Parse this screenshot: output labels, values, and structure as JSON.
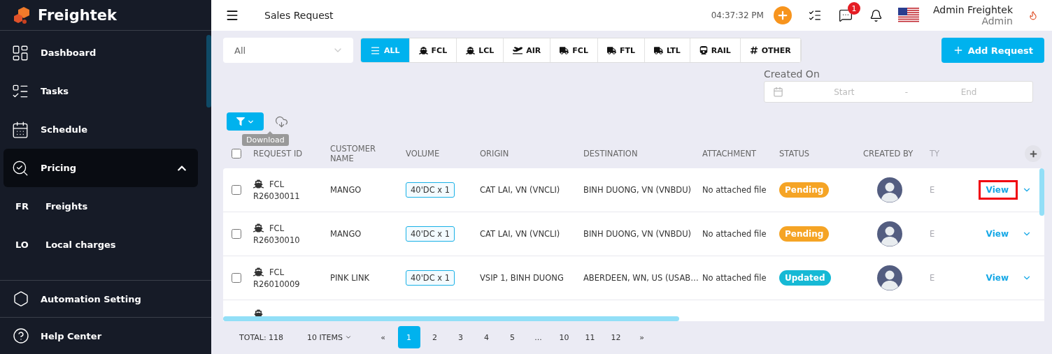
{
  "sidebar": {
    "logo": "Freightek",
    "items": [
      {
        "label": "Dashboard",
        "selected": false
      },
      {
        "label": "Tasks",
        "selected": false
      },
      {
        "label": "Schedule",
        "selected": false
      },
      {
        "label": "Pricing",
        "selected": true,
        "expanded": true,
        "children": [
          {
            "abbr": "FR",
            "label": "Freights"
          },
          {
            "abbr": "LO",
            "label": "Local charges"
          }
        ]
      }
    ],
    "bottom_items": [
      {
        "label": "Automation Setting"
      },
      {
        "label": "Help Center"
      }
    ]
  },
  "topbar": {
    "title": "Sales Request",
    "time": "04:37:32 PM",
    "chat_badge": "1",
    "user_name": "Admin Freightek",
    "user_role": "Admin"
  },
  "filters": {
    "select": "All",
    "tabs": [
      {
        "label": "ALL",
        "kind": "list",
        "selected": true
      },
      {
        "label": "FCL",
        "kind": "ship",
        "selected": false
      },
      {
        "label": "LCL",
        "kind": "ship",
        "selected": false
      },
      {
        "label": "AIR",
        "kind": "plane",
        "selected": false
      },
      {
        "label": "FCL",
        "kind": "truck",
        "selected": false
      },
      {
        "label": "FTL",
        "kind": "truck",
        "selected": false
      },
      {
        "label": "LTL",
        "kind": "truck",
        "selected": false
      },
      {
        "label": "RAIL",
        "kind": "rail",
        "selected": false
      },
      {
        "label": "OTHER",
        "kind": "hash",
        "selected": false
      }
    ],
    "add_button": "Add Request",
    "created_on": {
      "label": "Created On",
      "start_placeholder": "Start",
      "separator": "-",
      "end_placeholder": "End"
    }
  },
  "tooltip": "Download",
  "table": {
    "all_checked": false,
    "columns": [
      "REQUEST ID",
      "CUSTOMER NAME",
      "VOLUME",
      "ORIGIN",
      "DESTINATION",
      "ATTACHMENT",
      "STATUS",
      "CREATED BY",
      "TY"
    ],
    "rows": [
      {
        "checked": false,
        "mode": "FCL",
        "id": "R26030011",
        "customer": "MANGO",
        "volume": "40'DC x 1",
        "origin": "CAT LAI, VN (VNCLI)",
        "destination": "BINH DUONG, VN (VNBDU)",
        "attachment": "No attached file",
        "status": {
          "label": "Pending",
          "color": "#f5a425"
        },
        "column_9": "E",
        "action": "View",
        "highlighted": true
      },
      {
        "checked": false,
        "mode": "FCL",
        "id": "R26030010",
        "customer": "MANGO",
        "volume": "40'DC x 1",
        "origin": "CAT LAI, VN (VNCLI)",
        "destination": "BINH DUONG, VN (VNBDU)",
        "attachment": "No attached file",
        "status": {
          "label": "Pending",
          "color": "#f5a425"
        },
        "column_9": "E",
        "action": "View",
        "highlighted": false
      },
      {
        "checked": false,
        "mode": "FCL",
        "id": "R26010009",
        "customer": "PINK LINK",
        "volume": "40'DC x 1",
        "origin": "VSIP 1, BINH DUONG",
        "destination": "ABERDEEN, WN, US (USAB…",
        "attachment": "No attached file",
        "status": {
          "label": "Updated",
          "color": "#16b9d5"
        },
        "column_9": "E",
        "action": "View",
        "highlighted": false
      }
    ]
  },
  "pagination": {
    "total": "TOTAL: 118",
    "page_size": "10 ITEMS",
    "prev": "«",
    "pages": [
      {
        "label": "1",
        "selected": true
      },
      {
        "label": "2",
        "selected": false
      },
      {
        "label": "3",
        "selected": false
      },
      {
        "label": "4",
        "selected": false
      },
      {
        "label": "5",
        "selected": false
      },
      {
        "label": "...",
        "selected": false
      },
      {
        "label": "10",
        "selected": false
      },
      {
        "label": "11",
        "selected": false
      },
      {
        "label": "12",
        "selected": false
      }
    ],
    "next": "»"
  }
}
